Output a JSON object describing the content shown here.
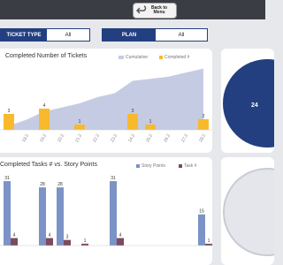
{
  "header": {
    "back_button_label": "Back to\nMenu"
  },
  "filters": {
    "ticket_type": {
      "label": "TICKET TYPE",
      "value": "All"
    },
    "plan": {
      "label": "PLAN",
      "value": "All"
    }
  },
  "colors": {
    "navy": "#233f80",
    "cumulative": "#c5cbe3",
    "completed": "#f8b92d",
    "story_points": "#7b93c6",
    "task": "#7d4a5f"
  },
  "completed_tickets": {
    "title": "Completed Number of Tickets",
    "legend": {
      "cumulative": "Cumulative",
      "completed": "Completed #"
    }
  },
  "tasks_vs_points": {
    "title": "Completed Tasks # vs. Story Points",
    "legend": {
      "story_points": "Story Points",
      "task": "Task #"
    }
  },
  "pie_card": {
    "value_label": "24"
  },
  "chart_data": [
    {
      "type": "bar",
      "title": "Completed Number of Tickets",
      "categories": [
        "",
        "18.2",
        "19.2",
        "20.2",
        "21.2",
        "22.2",
        "23.2",
        "24.2",
        "25.2",
        "26.2",
        "27.2",
        "28.2"
      ],
      "series": [
        {
          "name": "Cumulative",
          "type": "area",
          "values": [
            2,
            5,
            9,
            11,
            13,
            16,
            18,
            24,
            25,
            26,
            28,
            30
          ]
        },
        {
          "name": "Completed #",
          "values": [
            3,
            0,
            4,
            0,
            1,
            0,
            0,
            3,
            1,
            0,
            0,
            2
          ]
        }
      ],
      "data_labels": [
        "3",
        "",
        "4",
        "",
        "1",
        "",
        "",
        "3",
        "1",
        "",
        "",
        "2"
      ],
      "ylim": [
        0,
        32
      ]
    },
    {
      "type": "bar",
      "title": "Completed Tasks # vs. Story Points",
      "categories": [
        "",
        "",
        "",
        "",
        "",
        "",
        "",
        "",
        "",
        "",
        "",
        ""
      ],
      "series": [
        {
          "name": "Story Points",
          "values": [
            31,
            0,
            28,
            28,
            0,
            0,
            31,
            0,
            0,
            0,
            0,
            15
          ]
        },
        {
          "name": "Task #",
          "values": [
            4,
            0,
            4,
            3,
            1,
            0,
            4,
            0,
            0,
            0,
            0,
            1
          ]
        }
      ],
      "ylim": [
        0,
        34
      ]
    }
  ]
}
